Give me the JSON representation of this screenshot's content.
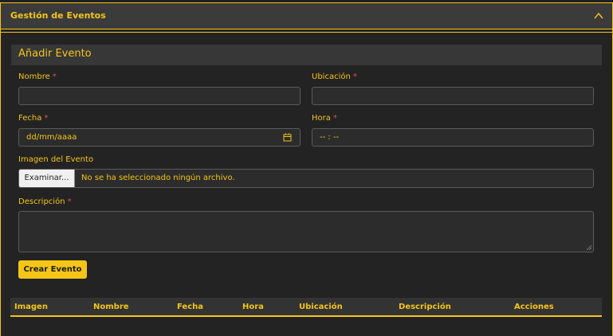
{
  "header": {
    "title": "Gestión de Eventos",
    "collapse_icon": "chevron-up-icon"
  },
  "form": {
    "section_title": "Añadir Evento",
    "required_mark": "*",
    "nombre_label": "Nombre",
    "ubicacion_label": "Ubicación",
    "fecha_label": "Fecha",
    "fecha_placeholder": "dd/mm/aaaa",
    "hora_label": "Hora",
    "hora_placeholder": "-- : --",
    "imagen_label": "Imagen del Evento",
    "file_button_label": "Examinar...",
    "file_status": "No se ha seleccionado ningún archivo.",
    "descripcion_label": "Descripción",
    "submit_label": "Crear Evento"
  },
  "table": {
    "columns": [
      "Imagen",
      "Nombre",
      "Fecha",
      "Hora",
      "Ubicación",
      "Descripción",
      "Acciones"
    ]
  },
  "colors": {
    "accent": "#f5c518",
    "background": "#232323",
    "required": "#d9534f"
  }
}
